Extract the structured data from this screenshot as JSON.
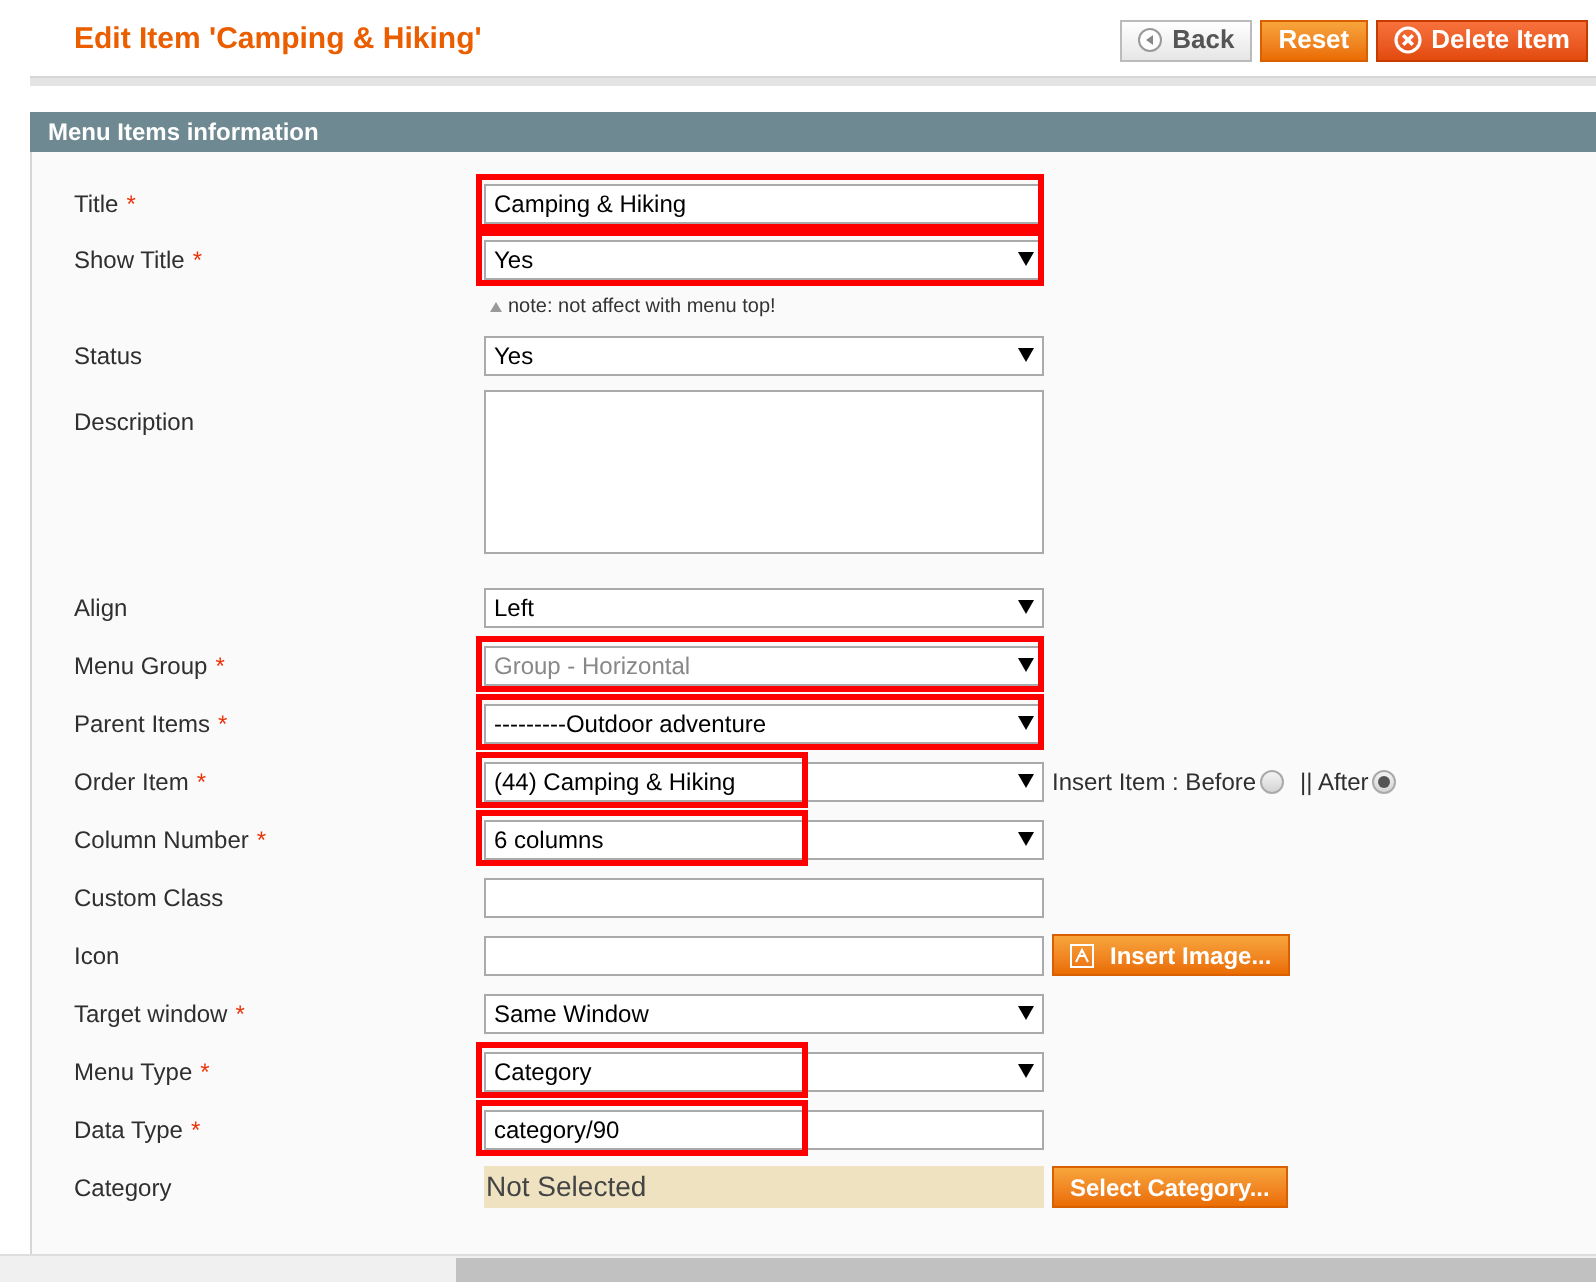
{
  "page_title": "Edit Item 'Camping & Hiking'",
  "header_buttons": [
    {
      "kind": "back",
      "label": "Back"
    },
    {
      "kind": "reset",
      "label": "Reset"
    },
    {
      "kind": "delete",
      "label": "Delete Item"
    }
  ],
  "section": {
    "title": "Menu Items information",
    "fields": [
      {
        "label": "Title",
        "required_mark": "*",
        "kind": "text",
        "value": "Camping & Hiking",
        "highlighted": true,
        "highlight_partial": false
      },
      {
        "label": "Show Title",
        "required_mark": "*",
        "kind": "select",
        "value": "Yes",
        "highlighted": true,
        "highlight_partial": false,
        "note": "note: not affect with menu top!"
      },
      {
        "label": "Status",
        "kind": "select",
        "value": "Yes"
      },
      {
        "label": "Description",
        "kind": "textarea"
      },
      {
        "label": "Align",
        "kind": "select",
        "value": "Left"
      },
      {
        "label": "Menu Group",
        "required_mark": "*",
        "kind": "select",
        "value": "Group - Horizontal",
        "disabled": true,
        "highlighted": true,
        "highlight_partial": false
      },
      {
        "label": "Parent Items",
        "required_mark": "*",
        "kind": "select",
        "value": "---------Outdoor adventure",
        "highlighted": true,
        "highlight_partial": false
      },
      {
        "label": "Order Item",
        "required_mark": "*",
        "kind": "select",
        "value": "(44) Camping & Hiking",
        "highlighted": true,
        "highlight_partial": true,
        "radios": [
          {
            "label": "Insert Item : Before",
            "selected": false
          },
          {
            "label": "|| After",
            "selected": true
          }
        ]
      },
      {
        "label": "Column Number",
        "required_mark": "*",
        "kind": "select",
        "value": "6 columns",
        "highlighted": true,
        "highlight_partial": true
      },
      {
        "label": "Custom Class",
        "kind": "text"
      },
      {
        "label": "Icon",
        "kind": "text",
        "button": "Insert Image..."
      },
      {
        "label": "Target window",
        "required_mark": "*",
        "kind": "select",
        "value": "Same Window"
      },
      {
        "label": "Menu Type",
        "required_mark": "*",
        "kind": "select",
        "value": "Category",
        "highlighted": true,
        "highlight_partial": true
      },
      {
        "label": "Data Type",
        "required_mark": "*",
        "kind": "text",
        "value": "category/90",
        "highlighted": true,
        "highlight_partial": true
      },
      {
        "label": "Category",
        "kind": "chooser",
        "value": "Not Selected",
        "button": "Select Category..."
      }
    ]
  }
}
